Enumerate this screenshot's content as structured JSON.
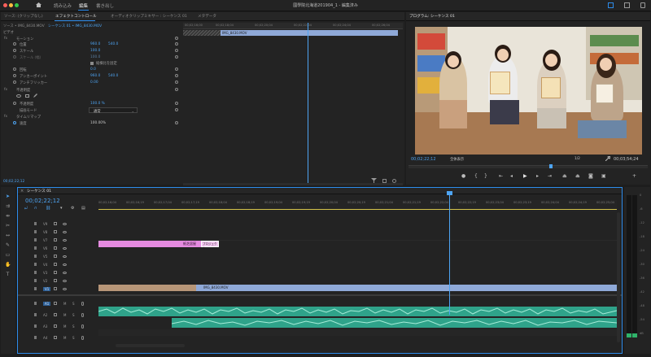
{
  "app": {
    "title": "國學院北海道201904_1 - 編集済み",
    "workspaces": [
      "読み込み",
      "編集",
      "書き出し"
    ],
    "active_workspace": "編集"
  },
  "source_panel": {
    "tabs": [
      "ソース: (クリップなし)",
      "エフェクトコントロール",
      "オーディオクリップミキサー : シーケンス 01",
      "メタデータ"
    ],
    "clip_paths": [
      "ソース • IMG_8430.MOV",
      "シーケンス 01 • IMG_8430.MOV"
    ],
    "section_video": "ビデオ",
    "properties": {
      "motion": "モーション",
      "position": {
        "label": "位置",
        "x": "960.0",
        "y": "540.0"
      },
      "scale": {
        "label": "スケール",
        "value": "100.0"
      },
      "scale_width": {
        "label": "スケール (幅)",
        "value": "100.0"
      },
      "uniform_scale": "縦横比を固定",
      "rotation": {
        "label": "回転",
        "value": "0.0"
      },
      "anchor": {
        "label": "アンカーポイント",
        "x": "960.0",
        "y": "540.0"
      },
      "antiflicker": {
        "label": "アンチフリッカー",
        "value": "0.00"
      },
      "opacity_section": "不透明度",
      "opacity": {
        "label": "不透明度",
        "value": "100.0 %"
      },
      "blend": {
        "label": "描画モード",
        "value": "通常"
      },
      "time_remap": "タイムリマップ",
      "speed": {
        "label": "速度",
        "value": "100.00%"
      }
    },
    "mini_clip": "IMG_8430.MOV",
    "mini_ruler": [
      "00;02;16;00",
      "00;02;18;04",
      "00;02;20;04",
      "00;02;22;04",
      "00;02;24;04",
      "00;02;26;04"
    ],
    "timecode": "00;02;22;12"
  },
  "program_monitor": {
    "tab": "プログラム: シーケンス 01",
    "timecode": "00;02;22;12",
    "fit": "全体表示",
    "quality": "1/2",
    "duration": "00;03;54;24"
  },
  "timeline": {
    "tab": "シーケンス 01",
    "timecode": "00;02;22;12",
    "ruler": [
      "00;02;16;04",
      "00;02;16;19",
      "00;02;17;04",
      "00;02;17;19",
      "00;02;18;04",
      "00;02;18;19",
      "00;02;19;04",
      "00;02;19;19",
      "00;02;20;04",
      "00;02;20;19",
      "00;02;21;04",
      "00;02;21;19",
      "00;02;22;04",
      "00;02;22;19",
      "00;02;23;04",
      "00;02;23;19",
      "00;02;24;04",
      "00;02;24;19",
      "00;02;25;04"
    ],
    "video_tracks": [
      "V9",
      "V8",
      "V7",
      "V6",
      "V5",
      "V4",
      "V3",
      "V2",
      "V1"
    ],
    "audio_tracks": [
      "A1",
      "A2",
      "A3",
      "A4"
    ],
    "title_clip_1": "紙芝居屋",
    "title_clip_2": "プロジェクト",
    "v1_clip": "IMG_8430.MOV",
    "meter_scale": [
      "0",
      "-6",
      "-12",
      "-18",
      "-24",
      "-30",
      "-36",
      "-42",
      "-48",
      "-54",
      "dB"
    ]
  },
  "colors": {
    "accent": "#2d8ceb",
    "video_clip": "#8fa9d8",
    "title_clip": "#e58be0",
    "audio_clip": "#3bb59a",
    "playhead": "#4ea4f2"
  }
}
